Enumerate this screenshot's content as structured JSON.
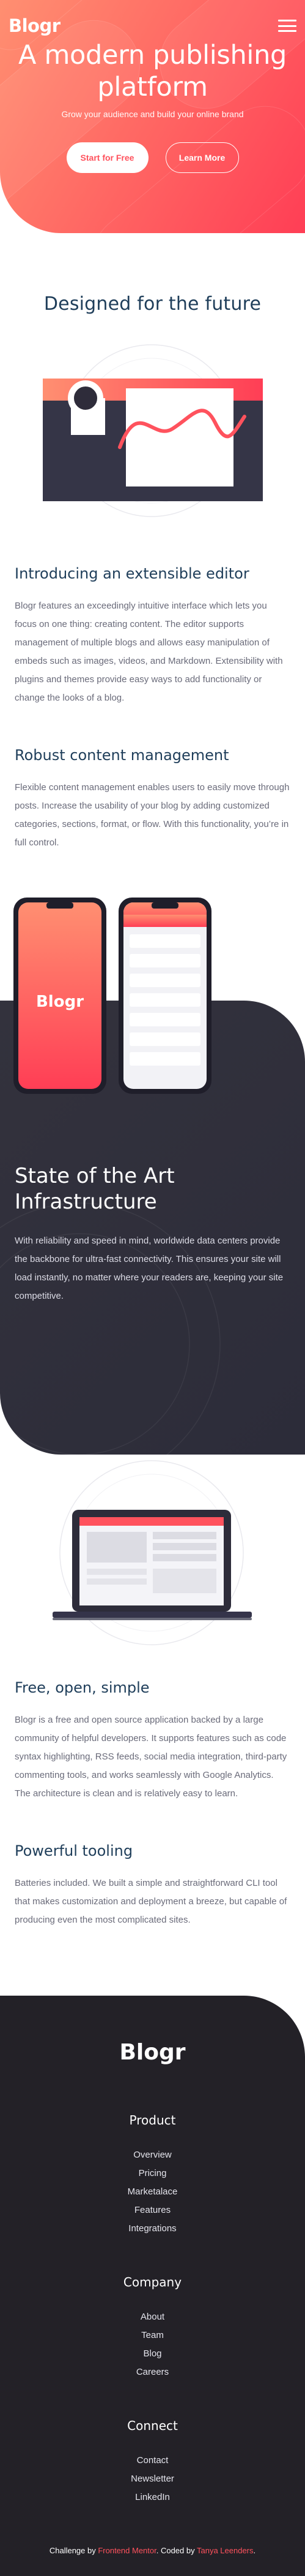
{
  "header": {
    "logo": "Blogr",
    "title": "A modern publishing platform",
    "tagline": "Grow your audience and build your online brand",
    "buttons": {
      "primary": "Start for Free",
      "secondary": "Learn More"
    }
  },
  "designed": {
    "title": "Designed for the future",
    "features": [
      {
        "title": "Introducing an extensible editor",
        "text": "Blogr features an exceedingly intuitive interface which lets you focus on one thing: creating content. The editor supports management of multiple blogs and allows easy manipulation of embeds such as images, videos, and Markdown. Extensibility with plugins and themes provide easy ways to add functionality or change the looks of a blog."
      },
      {
        "title": "Robust content management",
        "text": "Flexible content management enables users to easily move through posts. Increase the usability of your blog by adding customized categories, sections, format, or flow. With this functionality, you’re in full control."
      }
    ]
  },
  "phone_logo": "Blogr",
  "infrastructure": {
    "title": "State of the Art Infrastructure",
    "text": "With reliability and speed in mind, worldwide data centers provide the backbone for ultra-fast connectivity. This ensures your site will load instantly, no matter where your readers are, keeping your site competitive."
  },
  "features2": [
    {
      "title": "Free, open, simple",
      "text": "Blogr is a free and open source application backed by a large community of helpful developers. It supports features such as code syntax highlighting, RSS feeds, social media integration, third-party commenting tools, and works seamlessly with Google Analytics. The architecture is clean and is relatively easy to learn."
    },
    {
      "title": "Powerful tooling",
      "text": "Batteries included. We built a simple and straightforward CLI tool that makes customization and deployment a breeze, but capable of producing even the most complicated sites."
    }
  ],
  "footer": {
    "logo": "Blogr",
    "columns": [
      {
        "title": "Product",
        "links": [
          "Overview",
          "Pricing",
          "Marketalace",
          "Features",
          "Integrations"
        ]
      },
      {
        "title": "Company",
        "links": [
          "About",
          "Team",
          "Blog",
          "Careers"
        ]
      },
      {
        "title": "Connect",
        "links": [
          "Contact",
          "Newsletter",
          "LinkedIn"
        ]
      }
    ],
    "attribution": {
      "prefix": "Challenge by ",
      "mentor": "Frontend Mentor",
      "middle": ". Coded by ",
      "author": "Tanya Leenders",
      "suffix": "."
    }
  },
  "colors": {
    "hero_start": "#ff8f71",
    "hero_end": "#ff3e55",
    "heading": "#1f3e5a",
    "body_text": "#6a6b7a",
    "dark_band": "#33323d",
    "footer_bg": "#232127",
    "accent": "#ff525d"
  }
}
